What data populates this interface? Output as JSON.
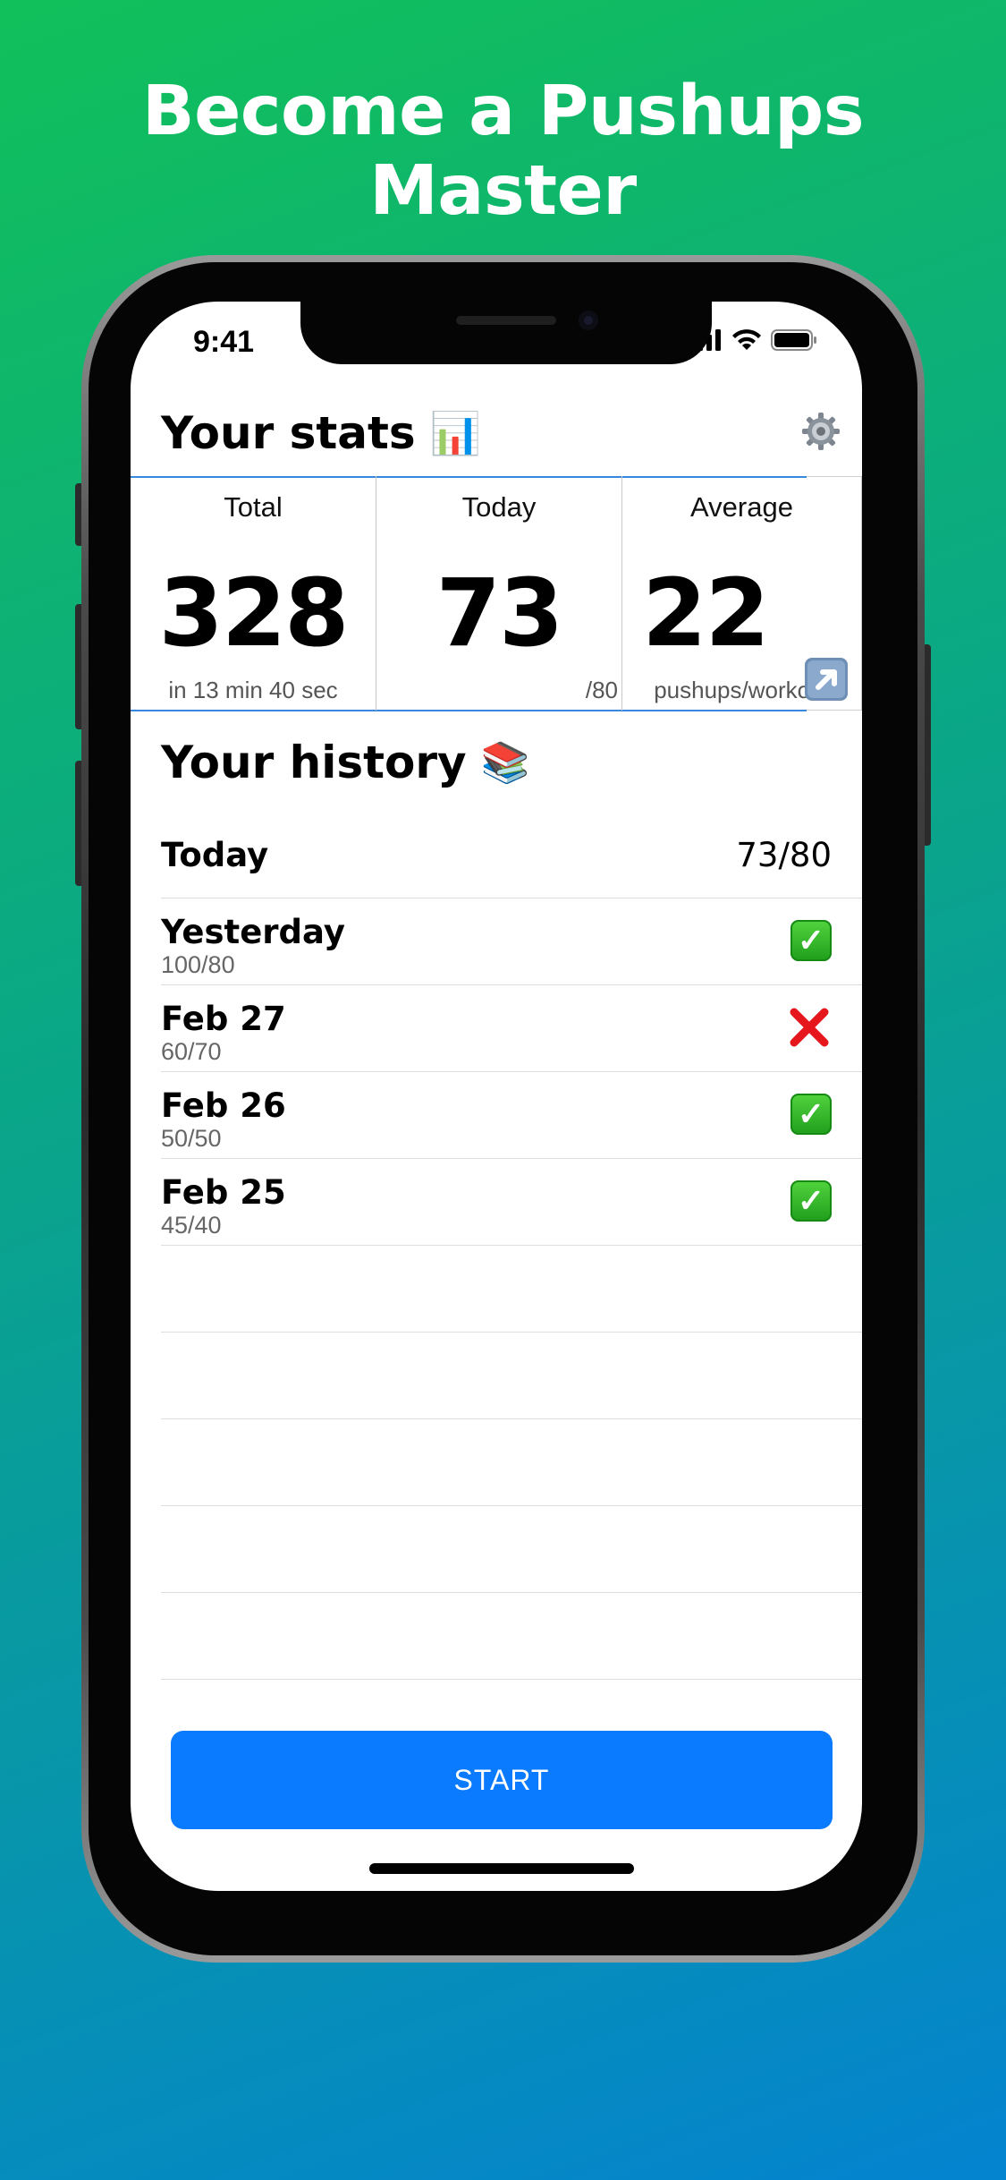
{
  "headline": "Become a Pushups Master",
  "status_bar": {
    "time": "9:41"
  },
  "stats": {
    "title": "Your stats",
    "title_emoji": "📊",
    "settings_icon": "gear-icon",
    "total": {
      "label": "Total",
      "value": "328",
      "sub": "in 13 min 40 sec"
    },
    "today": {
      "label": "Today",
      "value": "73",
      "sub": "/80"
    },
    "average": {
      "label": "Average",
      "value": "22",
      "sub": "pushups/workout",
      "trend_icon": "arrow-up-right-icon"
    }
  },
  "history": {
    "title": "Your history",
    "title_emoji": "📚",
    "today": {
      "label": "Today",
      "value": "73/80"
    },
    "rows": [
      {
        "date": "Yesterday",
        "result": "100/80",
        "status": "done"
      },
      {
        "date": "Feb 27",
        "result": "60/70",
        "status": "missed"
      },
      {
        "date": "Feb 26",
        "result": "50/50",
        "status": "done"
      },
      {
        "date": "Feb 25",
        "result": "45/40",
        "status": "done"
      }
    ]
  },
  "start_button": "START",
  "colors": {
    "accent": "#0a7aff",
    "done": "#2fb52a",
    "missed": "#e5161c",
    "gradient_start": "#11c05a",
    "gradient_end": "#0483cf"
  }
}
